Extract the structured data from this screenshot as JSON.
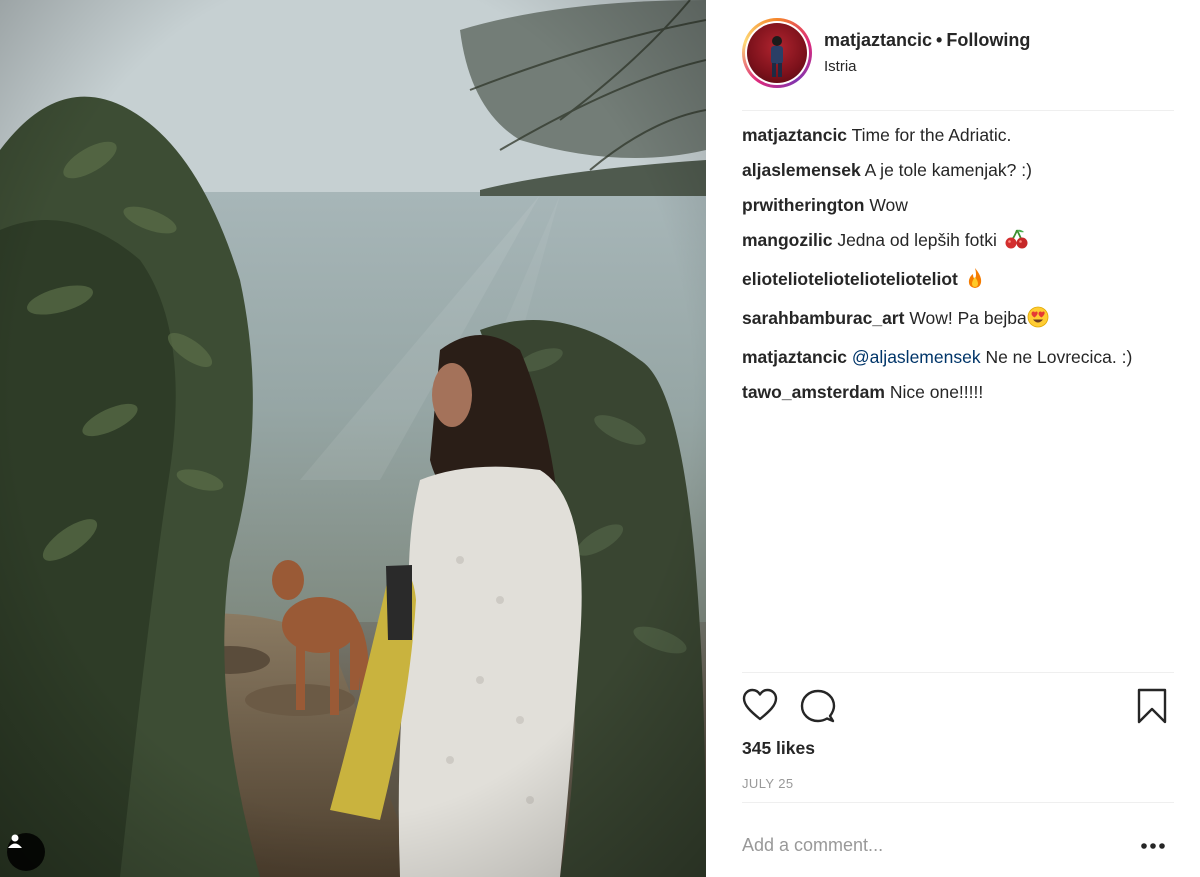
{
  "post": {
    "header": {
      "username": "matjaztancic",
      "separator": "•",
      "follow_status": "Following",
      "location": "Istria"
    },
    "comments": [
      {
        "user": "matjaztancic",
        "text": "Time for the Adriatic."
      },
      {
        "user": "aljaslemensek",
        "text": "A je tole kamenjak? :)"
      },
      {
        "user": "prwitherington",
        "text": "Wow"
      },
      {
        "user": "mangozilic",
        "text": "Jedna od lepših fotki",
        "emoji": "cherries-icon"
      },
      {
        "user": "elioteliotelioteliotelioteliot",
        "text": "",
        "emoji": "fire-icon"
      },
      {
        "user": "sarahbamburac_art",
        "text": "Wow! Pa bejba",
        "emoji": "heart-eyes-icon"
      },
      {
        "user": "matjaztancic",
        "mention": "@aljaslemensek",
        "text": "Ne ne Lovrecica. :)"
      },
      {
        "user": "tawo_amsterdam",
        "text": "Nice one!!!!!"
      }
    ],
    "likes": "345 likes",
    "date": "JULY 25",
    "comment_placeholder": "Add a comment...",
    "icons": {
      "like": "heart-outline-icon",
      "comment": "speech-bubble-icon",
      "save": "bookmark-icon",
      "more": "ellipsis-icon",
      "user_tag": "user-tag-icon"
    }
  }
}
